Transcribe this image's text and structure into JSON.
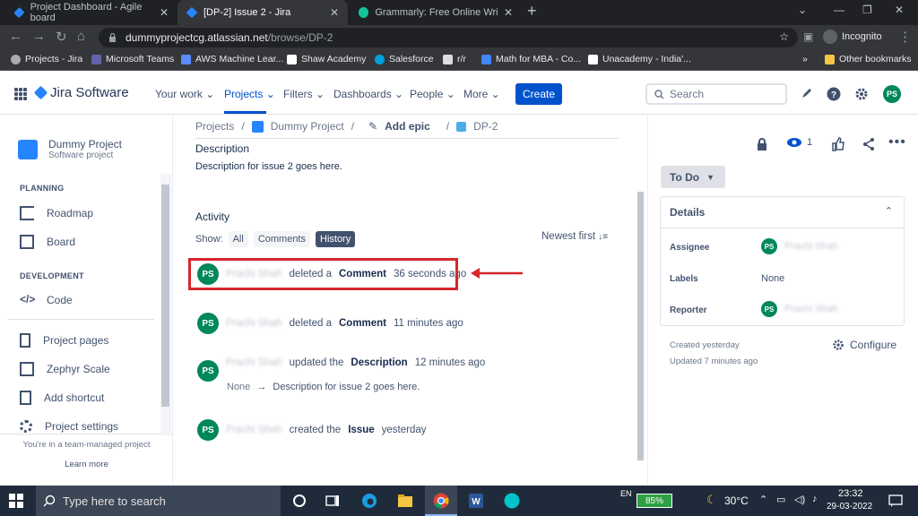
{
  "browser": {
    "tabs": [
      {
        "label": "Project Dashboard - Agile board",
        "active": false
      },
      {
        "label": "[DP-2] Issue 2 - Jira",
        "active": true
      },
      {
        "label": "Grammarly: Free Online Writing A",
        "active": false
      }
    ],
    "url_host": "dummyprojectcg.atlassian.net",
    "url_path": "/browse/DP-2",
    "profile_label": "Incognito",
    "bookmarks": [
      "Projects - Jira",
      "Microsoft Teams",
      "AWS Machine Lear...",
      "Shaw Academy",
      "Salesforce",
      "r/r",
      "Math for MBA - Co...",
      "Unacademy - India'..."
    ],
    "bookmarks_more": "»",
    "other_bookmarks": "Other bookmarks"
  },
  "jira_top": {
    "product": "Jira Software",
    "nav": [
      "Your work",
      "Projects",
      "Filters",
      "Dashboards",
      "People",
      "More"
    ],
    "create_label": "Create",
    "search_placeholder": "Search",
    "user_initials": "PS"
  },
  "sidebar": {
    "project_name": "Dummy Project",
    "project_type": "Software project",
    "planning_label": "PLANNING",
    "planning_items": [
      "Roadmap",
      "Board"
    ],
    "development_label": "DEVELOPMENT",
    "development_items": [
      "Code"
    ],
    "other_items": [
      "Project pages",
      "Zephyr Scale",
      "Add shortcut",
      "Project settings"
    ],
    "team_note": "You're in a team-managed project",
    "learn_more": "Learn more"
  },
  "issue": {
    "breadcrumbs": [
      "Projects",
      "Dummy Project",
      "Add epic",
      "DP-2"
    ],
    "description_heading": "Description",
    "description_text": "Description for issue 2 goes here.",
    "activity_heading": "Activity",
    "show_label": "Show:",
    "filters": [
      "All",
      "Comments",
      "History"
    ],
    "selected_filter": "History",
    "sort_label": "Newest first",
    "entries": [
      {
        "initials": "PS",
        "user": "Prachi Shah",
        "action": "deleted a",
        "object": "Comment",
        "time": "36 seconds ago"
      },
      {
        "initials": "PS",
        "user": "Prachi Shah",
        "action": "deleted a",
        "object": "Comment",
        "time": "11 minutes ago"
      },
      {
        "initials": "PS",
        "user": "Prachi Shah",
        "action": "updated the",
        "object": "Description",
        "time": "12 minutes ago",
        "from": "None",
        "arrow": "→",
        "to": "Description for issue 2 goes here."
      },
      {
        "initials": "PS",
        "user": "Prachi Shah",
        "action": "created the",
        "object": "Issue",
        "time": "yesterday"
      }
    ]
  },
  "right_panel": {
    "watchers": "1",
    "status": "To Do",
    "details_heading": "Details",
    "assignee_label": "Assignee",
    "assignee_name": "Prachi Shah",
    "assignee_initials": "PS",
    "labels_label": "Labels",
    "labels_value": "None",
    "reporter_label": "Reporter",
    "reporter_name": "Prachi Shah",
    "reporter_initials": "PS",
    "created": "Created yesterday",
    "updated": "Updated 7 minutes ago",
    "configure": "Configure"
  },
  "taskbar": {
    "search_placeholder": "Type here to search",
    "lang": "EN",
    "battery": "85%",
    "temperature": "30°C",
    "time": "23:32",
    "date": "29-03-2022"
  },
  "colors": {
    "jira_blue": "#0052cc",
    "avatar_green": "#00875a",
    "highlight_red": "#d7262b"
  }
}
